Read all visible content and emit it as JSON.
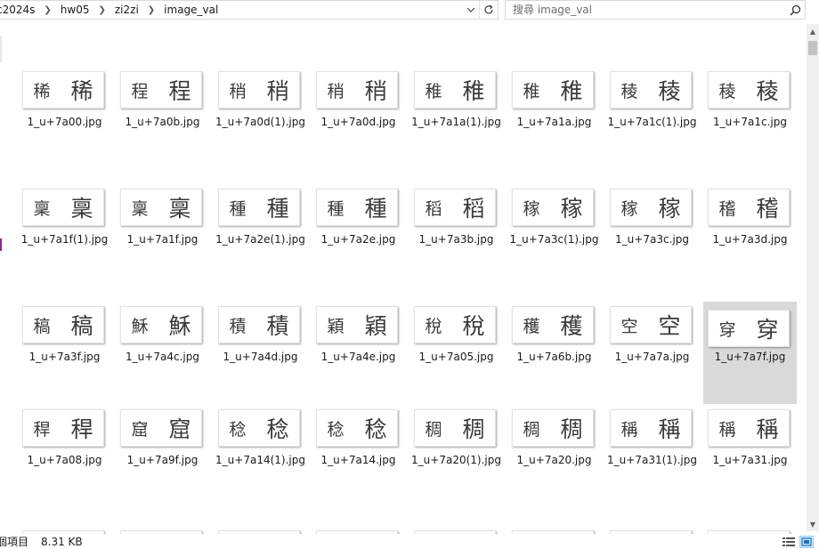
{
  "address": {
    "crumbs": [
      "c2024s",
      "hw05",
      "zi2zi",
      "image_val"
    ],
    "dropdown_icon": "chevron-down-icon",
    "refresh_icon": "refresh-icon"
  },
  "search": {
    "placeholder": "搜尋 image_val",
    "icon": "search-icon"
  },
  "files": [
    {
      "name": "1_u+7a00.jpg",
      "glyph": "稀"
    },
    {
      "name": "1_u+7a0b.jpg",
      "glyph": "程"
    },
    {
      "name": "1_u+7a0d(1).jpg",
      "glyph": "稍"
    },
    {
      "name": "1_u+7a0d.jpg",
      "glyph": "稍"
    },
    {
      "name": "1_u+7a1a(1).jpg",
      "glyph": "稚"
    },
    {
      "name": "1_u+7a1a.jpg",
      "glyph": "稚"
    },
    {
      "name": "1_u+7a1c(1).jpg",
      "glyph": "稜"
    },
    {
      "name": "1_u+7a1c.jpg",
      "glyph": "稜"
    },
    {
      "name": "1_u+7a1f(1).jpg",
      "glyph": "稟"
    },
    {
      "name": "1_u+7a1f.jpg",
      "glyph": "稟"
    },
    {
      "name": "1_u+7a2e(1).jpg",
      "glyph": "種"
    },
    {
      "name": "1_u+7a2e.jpg",
      "glyph": "種"
    },
    {
      "name": "1_u+7a3b.jpg",
      "glyph": "稻"
    },
    {
      "name": "1_u+7a3c(1).jpg",
      "glyph": "稼"
    },
    {
      "name": "1_u+7a3c.jpg",
      "glyph": "稼"
    },
    {
      "name": "1_u+7a3d.jpg",
      "glyph": "稽"
    },
    {
      "name": "1_u+7a3f.jpg",
      "glyph": "稿"
    },
    {
      "name": "1_u+7a4c.jpg",
      "glyph": "穌"
    },
    {
      "name": "1_u+7a4d.jpg",
      "glyph": "積"
    },
    {
      "name": "1_u+7a4e.jpg",
      "glyph": "穎"
    },
    {
      "name": "1_u+7a05.jpg",
      "glyph": "稅"
    },
    {
      "name": "1_u+7a6b.jpg",
      "glyph": "穫"
    },
    {
      "name": "1_u+7a7a.jpg",
      "glyph": "空"
    },
    {
      "name": "1_u+7a7f.jpg",
      "glyph": "穿",
      "selected": true
    },
    {
      "name": "1_u+7a08.jpg",
      "glyph": "稈"
    },
    {
      "name": "1_u+7a9f.jpg",
      "glyph": "窟"
    },
    {
      "name": "1_u+7a14(1).jpg",
      "glyph": "稔"
    },
    {
      "name": "1_u+7a14.jpg",
      "glyph": "稔"
    },
    {
      "name": "1_u+7a20(1).jpg",
      "glyph": "稠"
    },
    {
      "name": "1_u+7a20.jpg",
      "glyph": "稠"
    },
    {
      "name": "1_u+7a31(1).jpg",
      "glyph": "稱"
    },
    {
      "name": "1_u+7a31.jpg",
      "glyph": "稱"
    }
  ],
  "status": {
    "count": "個項目",
    "size": "8.31 KB"
  },
  "view_modes": [
    "details-view-icon",
    "large-icons-view-icon"
  ]
}
